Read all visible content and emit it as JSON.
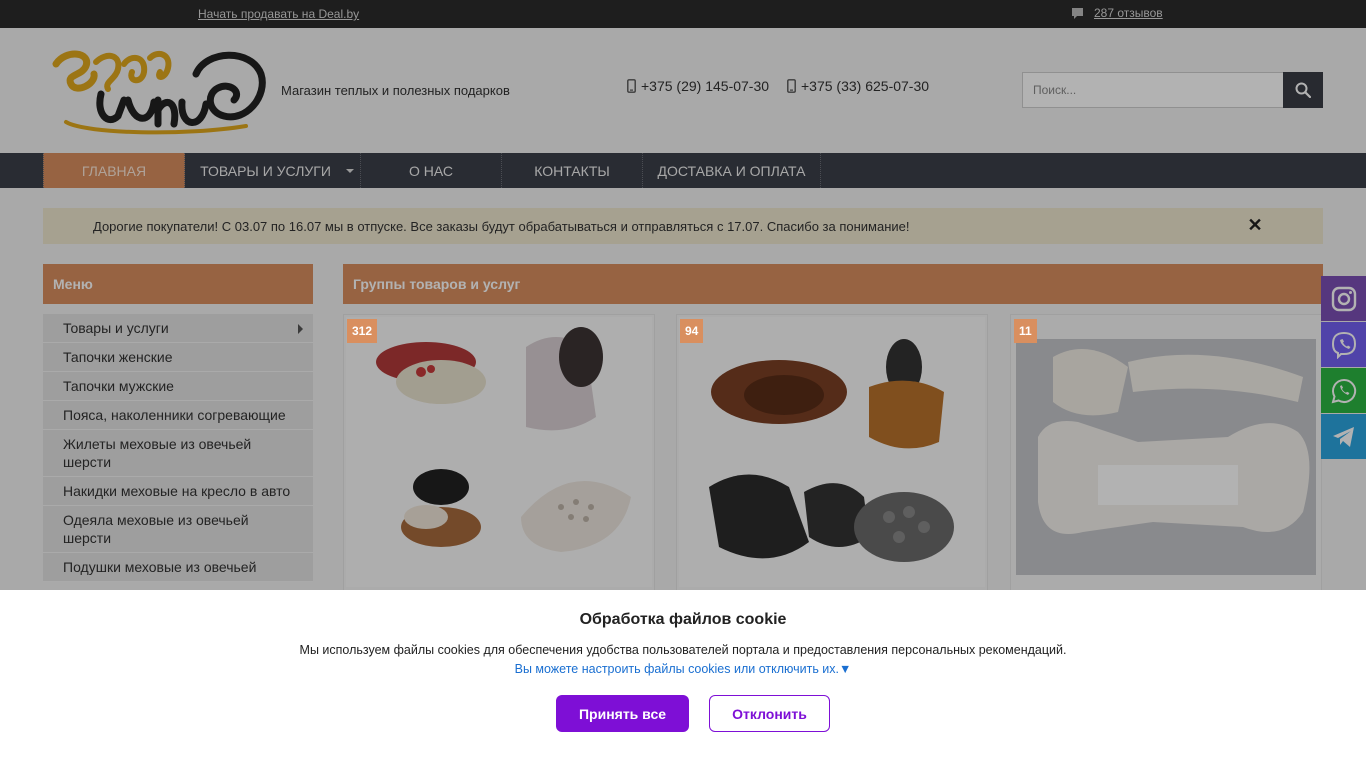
{
  "topbar": {
    "sell_link": "Начать продавать на Deal.by",
    "reviews_link": "287 отзывов"
  },
  "header": {
    "tagline": "Магазин теплых и полезных подарков",
    "phones": [
      "+375 (29) 145-07-30",
      "+375 (33) 625-07-30"
    ],
    "search_placeholder": "Поиск..."
  },
  "nav": {
    "items": [
      {
        "label": "ГЛАВНАЯ",
        "active": true
      },
      {
        "label": "ТОВАРЫ И УСЛУГИ",
        "has_dropdown": true
      },
      {
        "label": "О НАС"
      },
      {
        "label": "КОНТАКТЫ"
      },
      {
        "label": "ДОСТАВКА И ОПЛАТА"
      }
    ]
  },
  "notice": {
    "text": "Дорогие покупатели! С 03.07 по 16.07 мы в отпуске. Все заказы будут обрабатываться и отправляться с 17.07. Спасибо за понимание!",
    "close_icon": "close-icon"
  },
  "sidebar": {
    "title": "Меню",
    "items": [
      "Товары и услуги",
      "Тапочки женские",
      "Тапочки мужские",
      "Пояса, наколенники согревающие",
      "Жилеты меховые из овечьей шерсти",
      "Накидки меховые на кресло в авто",
      "Одеяла меховые из овечьей шерсти",
      "Подушки меховые из овечьей"
    ]
  },
  "main": {
    "title": "Группы товаров и услуг",
    "cards": [
      {
        "count": "312"
      },
      {
        "count": "94"
      },
      {
        "count": "11"
      }
    ]
  },
  "social": [
    "instagram-icon",
    "viber-icon",
    "whatsapp-icon",
    "telegram-icon"
  ],
  "colors": {
    "accent": "#d98f5f",
    "nav_bg": "#3b3f4a",
    "topbar_bg": "#2b2b2b",
    "cookie_button": "#7e0fd6",
    "instagram": "#7b4fb5",
    "viber": "#7360f2",
    "whatsapp": "#2cb742",
    "telegram": "#2ca5e0"
  },
  "cookie": {
    "title": "Обработка файлов cookie",
    "description": "Мы используем файлы cookies для обеспечения удобства пользователей портала и предоставления персональных рекомендаций.",
    "setup_link": "Вы можете настроить файлы cookies или отключить их.▼",
    "accept_label": "Принять все",
    "decline_label": "Отклонить"
  }
}
